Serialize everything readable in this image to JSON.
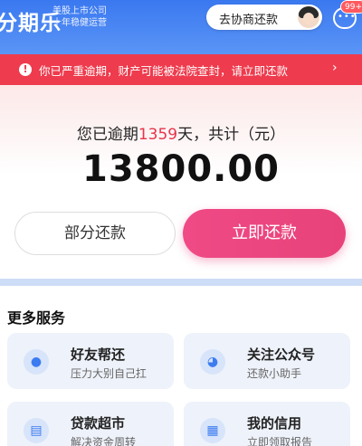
{
  "header": {
    "logo": "分期乐",
    "slogan_line1": "美股上市公司",
    "slogan_line2": "十年稳健运营",
    "agent_button_label": "去协商还款",
    "message_icon": "chat-bubble-icon",
    "message_badge": "99+"
  },
  "alert": {
    "icon": "warning-icon",
    "text": "你已严重逾期，财产可能被法院查封，请立即还款",
    "arrow": "›"
  },
  "repayment": {
    "overdue_prefix": "您已逾期",
    "overdue_days": "1359",
    "overdue_suffix": "天，共计（元）",
    "amount": "13800.00",
    "partial_button": "部分还款",
    "pay_now_button": "立即还款"
  },
  "services": {
    "title": "更多服务",
    "items": [
      {
        "icon": "user-help-icon",
        "title": "好友帮还",
        "subtitle": "压力大别自己扛"
      },
      {
        "icon": "wechat-icon",
        "title": "关注公众号",
        "subtitle": "还款小助手"
      },
      {
        "icon": "cart-icon",
        "title": "贷款超市",
        "subtitle": "解决资金周转"
      },
      {
        "icon": "credit-report-icon",
        "title": "我的信用",
        "subtitle": "立即领取报告"
      }
    ]
  },
  "colors": {
    "header_blue": "#3a78f0",
    "alert_red": "#ee3b4d",
    "pay_pink": "#e8427a",
    "overdue_days_red": "#e8344a"
  }
}
